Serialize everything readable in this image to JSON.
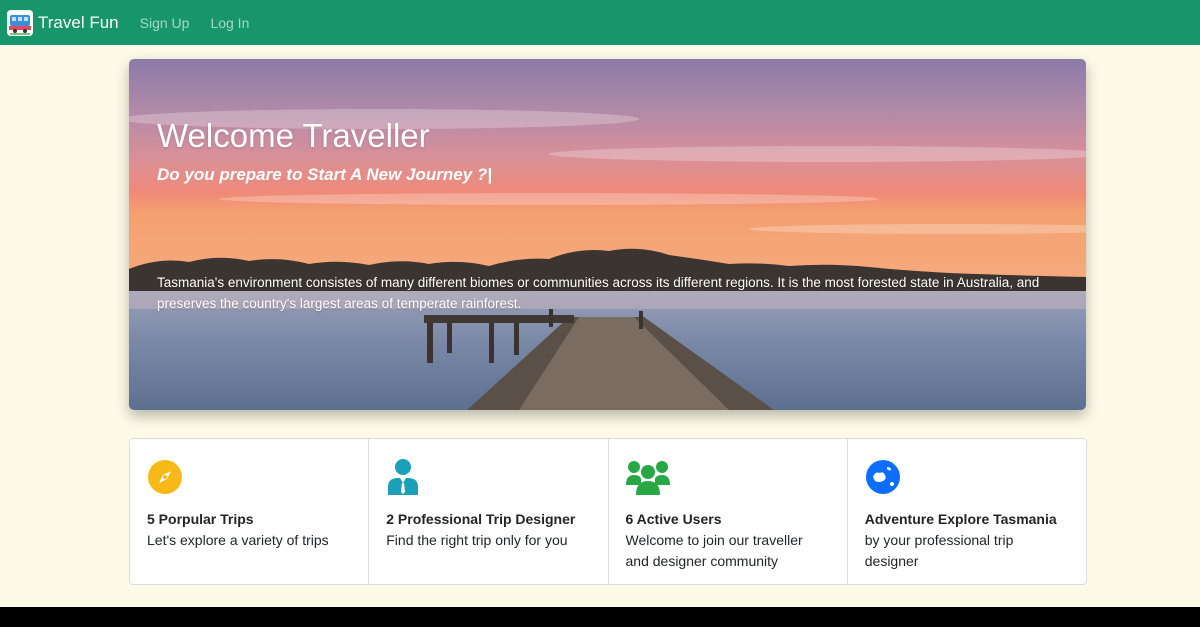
{
  "navbar": {
    "brand": "Travel Fun",
    "links": [
      "Sign Up",
      "Log In"
    ],
    "bg_color": "#16966a"
  },
  "hero": {
    "title": "Welcome Traveller",
    "subtitle": "Do you prepare to Start A New Journey ?|",
    "description": "Tasmania's environment consistes of many different biomes or communities across its different regions. It is the most forested state in Australia, and preserves the country's largest areas of temperate rainforest."
  },
  "features": [
    {
      "icon": "compass-icon",
      "color": "#f7b918",
      "title": "5 Porpular Trips",
      "text": "Let's explore a variety of trips"
    },
    {
      "icon": "user-tie-icon",
      "color": "#1aa0b8",
      "title": "2 Professional Trip Designer",
      "text": "Find the right trip only for you"
    },
    {
      "icon": "users-icon",
      "color": "#28a745",
      "title": "6 Active Users",
      "text": "Welcome to join our traveller and designer community"
    },
    {
      "icon": "globe-icon",
      "color": "#0d6efd",
      "title": "Adventure Explore Tasmania",
      "text": "by your professional trip designer"
    }
  ]
}
